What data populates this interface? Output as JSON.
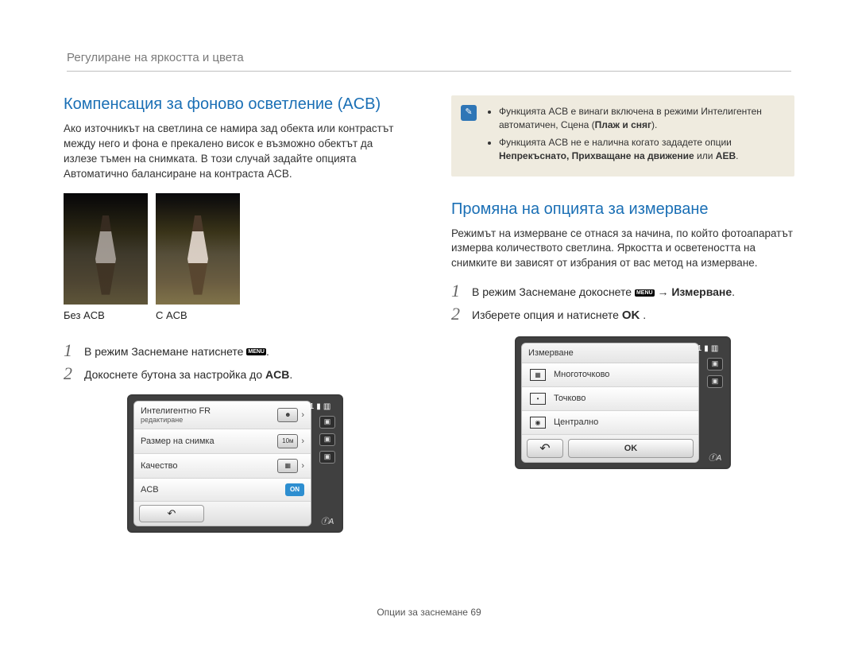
{
  "header": {
    "title": "Регулиране на яркостта и цвета"
  },
  "left": {
    "section_title": "Компенсация за фоново осветление (ACB)",
    "body": "Ако източникът на светлина се намира зад обекта или контрастът между него и фона е прекалено висок е възможно обектът да излезе тъмен на снимката. В този случай задайте опцията Автоматично балансиране на контраста ACB.",
    "caption_noacb": "Без ACB",
    "caption_acb": "С ACB",
    "step1": "В режим Заснемане натиснете",
    "step1_badge": "MENU",
    "step1_tail": ".",
    "step2_pre": "Докоснете бутона за настройка до ",
    "step2_bold": "ACB",
    "step2_tail": ".",
    "cam": {
      "row1_label": "Интелигентно FR",
      "row1_sub": "редактиране",
      "row1_val": "",
      "row2_label": "Размер на снимка",
      "row2_val": "10м",
      "row3_label": "Качество",
      "row3_val": "",
      "row4_label": "ACB",
      "row4_val": "ON",
      "page": "1",
      "flash": "ⓕA"
    }
  },
  "right": {
    "note": {
      "line1": "Функцията ACB е винаги включена в режими Интелигентен автоматичен, Сцена (",
      "line1_bold": "Плаж и сняг",
      "line1_tail": ").",
      "line2_pre": "Функцията ACB не е налична когато зададете опции ",
      "line2_bold": "Непрекъснато, Прихващане на движение",
      "line2_mid": " или ",
      "line2_bold2": "AEB",
      "line2_tail": "."
    },
    "section_title": "Промяна на опцията за измерване",
    "body": "Режимът на измерване се отнася за начина, по който фотоапаратът измерва количеството светлина. Яркостта и осветеността на снимките ви зависят от избрания от вас метод на измерване.",
    "step1_pre": "В режим Заснемане докоснете ",
    "step1_badge": "MENU",
    "step1_arrow": " → ",
    "step1_bold": "Измерване",
    "step1_tail": ".",
    "step2_pre": "Изберете опция и натиснете ",
    "step2_ok": "OK",
    "step2_tail": " .",
    "cam": {
      "title": "Измерване",
      "opt1": "Многоточково",
      "opt2": "Точково",
      "opt3": "Централно",
      "ok": "OK",
      "page": "1",
      "flash": "ⓕA"
    }
  },
  "footer": {
    "text": "Опции за заснемане  69"
  }
}
